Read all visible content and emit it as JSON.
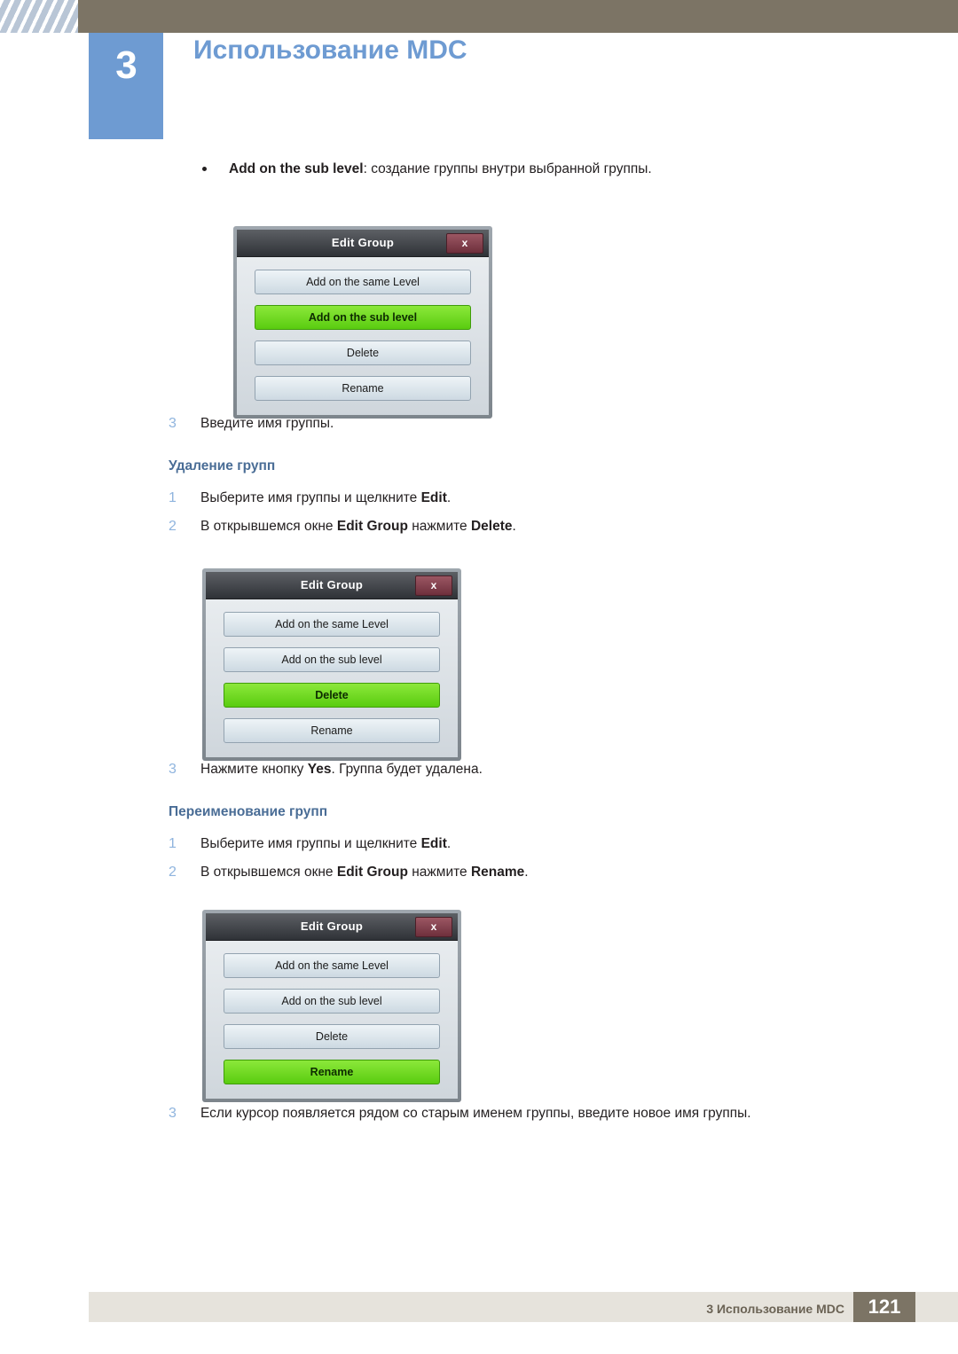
{
  "header": {
    "chapter_number": "3",
    "chapter_title": "Использование MDC"
  },
  "content": {
    "bullet": {
      "bold": "Add on the sub level",
      "rest": ": создание группы внутри выбранной группы."
    },
    "step_after_first_dialog": {
      "num": "3",
      "text": "Введите имя группы."
    },
    "section_delete": {
      "heading": "Удаление групп",
      "steps": [
        {
          "num": "1",
          "pre": "Выберите имя группы и щелкните ",
          "bold": "Edit",
          "post": "."
        },
        {
          "num": "2",
          "pre": "В открывшемся окне ",
          "bold": "Edit Group",
          "mid": " нажмите ",
          "bold2": "Delete",
          "post": "."
        },
        {
          "num": "3",
          "pre": "Нажмите кнопку ",
          "bold": "Yes",
          "post": ". Группа будет удалена."
        }
      ]
    },
    "section_rename": {
      "heading": "Переименование групп",
      "steps": [
        {
          "num": "1",
          "pre": "Выберите имя группы и щелкните ",
          "bold": "Edit",
          "post": "."
        },
        {
          "num": "2",
          "pre": "В открывшемся окне ",
          "bold": "Edit Group",
          "mid": " нажмите ",
          "bold2": "Rename",
          "post": "."
        },
        {
          "num": "3",
          "pre": "Если курсор появляется рядом со старым именем группы, введите новое имя группы.",
          "bold": "",
          "post": ""
        }
      ]
    }
  },
  "dialogs": [
    {
      "title": "Edit Group",
      "close_label": "x",
      "buttons": [
        {
          "label": "Add on the same Level",
          "highlighted": false
        },
        {
          "label": "Add on the sub level",
          "highlighted": true
        },
        {
          "label": "Delete",
          "highlighted": false
        },
        {
          "label": "Rename",
          "highlighted": false
        }
      ]
    },
    {
      "title": "Edit Group",
      "close_label": "x",
      "buttons": [
        {
          "label": "Add on the same Level",
          "highlighted": false
        },
        {
          "label": "Add on the sub level",
          "highlighted": false
        },
        {
          "label": "Delete",
          "highlighted": true
        },
        {
          "label": "Rename",
          "highlighted": false
        }
      ]
    },
    {
      "title": "Edit Group",
      "close_label": "x",
      "buttons": [
        {
          "label": "Add on the same Level",
          "highlighted": false
        },
        {
          "label": "Add on the sub level",
          "highlighted": false
        },
        {
          "label": "Delete",
          "highlighted": false
        },
        {
          "label": "Rename",
          "highlighted": true
        }
      ]
    }
  ],
  "footer": {
    "text": "3 Использование MDC",
    "page": "121"
  }
}
